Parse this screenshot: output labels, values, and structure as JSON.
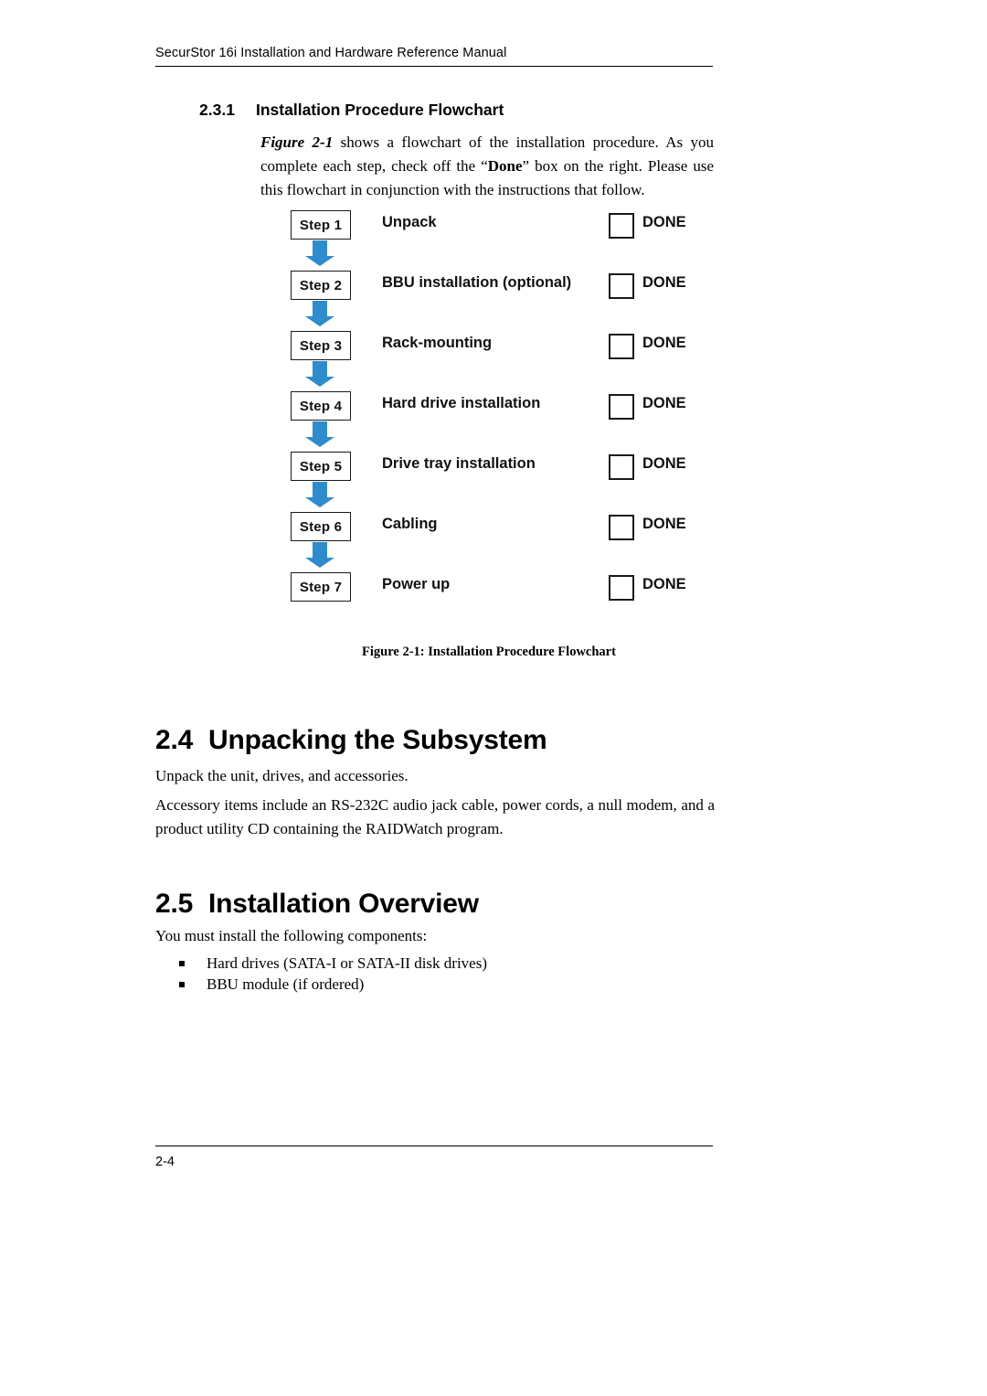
{
  "header": {
    "running_title": "SecurStor 16i Installation and Hardware Reference Manual"
  },
  "section_231": {
    "number": "2.3.1",
    "title": "Installation Procedure Flowchart",
    "paragraph_lead": "Figure 2-1",
    "paragraph_rest_1": " shows a flowchart of the installation procedure. As you complete each step, check off the “",
    "paragraph_bold": "Done",
    "paragraph_rest_2": "” box on the right. Please use this flowchart in conjunction with the instructions that follow."
  },
  "flowchart": {
    "done_label": "DONE",
    "steps": [
      {
        "step": "Step 1",
        "label": "Unpack"
      },
      {
        "step": "Step 2",
        "label": "BBU installation (optional)"
      },
      {
        "step": "Step 3",
        "label": "Rack-mounting"
      },
      {
        "step": "Step 4",
        "label": "Hard drive installation"
      },
      {
        "step": "Step 5",
        "label": "Drive tray installation"
      },
      {
        "step": "Step 6",
        "label": "Cabling"
      },
      {
        "step": "Step 7",
        "label": "Power up"
      }
    ],
    "caption": "Figure 2-1: Installation Procedure Flowchart"
  },
  "section_24": {
    "number": "2.4",
    "title": "Unpacking the Subsystem",
    "para1": "Unpack the unit, drives, and accessories.",
    "para2": "Accessory items include an RS-232C audio jack cable, power cords, a null modem, and a product utility CD containing the RAIDWatch program."
  },
  "section_25": {
    "number": "2.5",
    "title": "Installation Overview",
    "para1": "You must install the following components:",
    "bullets": [
      "Hard drives (SATA-I or SATA-II disk drives)",
      "BBU module (if ordered)"
    ]
  },
  "footer": {
    "page_number": "2-4"
  },
  "colors": {
    "arrow_blue": "#2e8bcc",
    "text": "#000000"
  }
}
